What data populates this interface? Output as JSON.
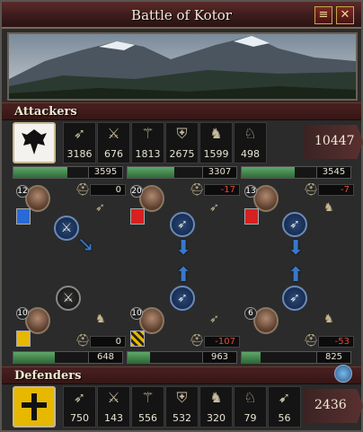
{
  "window": {
    "title": "Battle of Kotor",
    "minimize_icon": "scroll-icon",
    "close_label": "✕"
  },
  "attackers": {
    "label": "Attackers",
    "shield_icon": "eagle-shield-icon",
    "units": [
      {
        "icon": "archer-unit-icon",
        "glyph": "➶",
        "count": "3186"
      },
      {
        "icon": "light-infantry-icon",
        "glyph": "⚔",
        "count": "676"
      },
      {
        "icon": "pikemen-icon",
        "glyph": "⚚",
        "count": "1813"
      },
      {
        "icon": "heavy-infantry-icon",
        "glyph": "⛨",
        "count": "2675"
      },
      {
        "icon": "light-cavalry-icon",
        "glyph": "♞",
        "count": "1599"
      },
      {
        "icon": "knights-icon",
        "glyph": "♘",
        "count": "498"
      }
    ],
    "total": "10447",
    "flanks": [
      {
        "strength": "3595",
        "health": 0.72,
        "level": "12",
        "casualties": "0",
        "negative": false
      },
      {
        "strength": "3307",
        "health": 0.62,
        "level": "20",
        "casualties": "-17",
        "negative": true
      },
      {
        "strength": "3545",
        "health": 0.7,
        "level": "13",
        "casualties": "-7",
        "negative": true
      }
    ]
  },
  "defenders": {
    "label": "Defenders",
    "shield_icon": "cross-shield-icon",
    "units": [
      {
        "icon": "archer-unit-icon",
        "glyph": "➶",
        "count": "750"
      },
      {
        "icon": "light-infantry-icon",
        "glyph": "⚔",
        "count": "143"
      },
      {
        "icon": "pikemen-icon",
        "glyph": "⚚",
        "count": "556"
      },
      {
        "icon": "heavy-infantry-icon",
        "glyph": "⛨",
        "count": "532"
      },
      {
        "icon": "light-cavalry-icon",
        "glyph": "♞",
        "count": "320"
      },
      {
        "icon": "knights-icon",
        "glyph": "♘",
        "count": "79"
      },
      {
        "icon": "horse-archer-icon",
        "glyph": "➹",
        "count": "56"
      }
    ],
    "total": "2436",
    "flanks": [
      {
        "strength": "648",
        "health": 0.55,
        "level": "10",
        "casualties": "0",
        "negative": false
      },
      {
        "strength": "963",
        "health": 0.3,
        "level": "10",
        "casualties": "-107",
        "negative": true
      },
      {
        "strength": "825",
        "health": 0.25,
        "level": "6",
        "casualties": "-53",
        "negative": true
      }
    ]
  },
  "colors": {
    "health_bar": "#4f9a5a",
    "tactic_arrow": "#3a78c8",
    "negative": "#e84a3a"
  }
}
